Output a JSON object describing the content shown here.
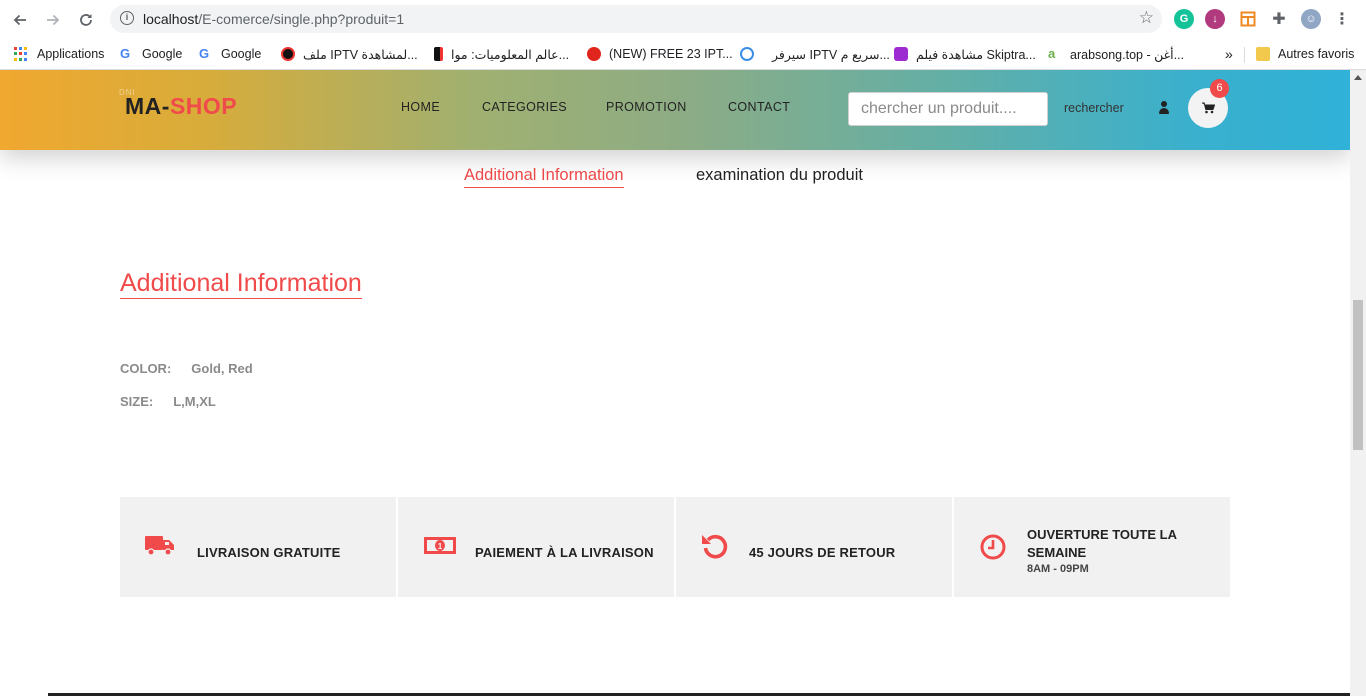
{
  "browser": {
    "url_host": "localhost",
    "url_path": "/E-comerce/single.php?produit=1",
    "bookmarks": [
      {
        "label": "Applications"
      },
      {
        "label": "Google"
      },
      {
        "label": "Google"
      },
      {
        "label": "ملف IPTV لمشاهدة..."
      },
      {
        "label": "عالم المعلوميات: موا..."
      },
      {
        "label": "(NEW) FREE 23 IPT..."
      },
      {
        "label": "سيرفر IPTV سريع م..."
      },
      {
        "label": "مشاهدة فيلم Skiptra..."
      },
      {
        "label": "arabsong.top - أغن..."
      }
    ],
    "more_bookmarks": "»",
    "other_bookmarks": "Autres favoris"
  },
  "header": {
    "logo_small": "DNI",
    "logo_ma": "MA-",
    "logo_shop": "SHOP",
    "menu": [
      "HOME",
      "CATEGORIES",
      "PROMOTION",
      "CONTACT"
    ],
    "search_placeholder": "chercher un produit....",
    "search_button": "rechercher",
    "cart_count": "6"
  },
  "tabs": {
    "active": "Additional Information",
    "other": "examination du produit"
  },
  "section": {
    "title": "Additional Information",
    "color_label": "COLOR:",
    "color_value": "Gold, Red",
    "size_label": "SIZE:",
    "size_value": "L,M,XL"
  },
  "features": {
    "shipping": "LIVRAISON GRATUITE",
    "payment": "PAIEMENT À LA LIVRAISON",
    "returns": "45 JOURS DE RETOUR",
    "hours_title": "OUVERTURE TOUTE LA SEMAINE",
    "hours_sub": "8AM - 09PM"
  },
  "colors": {
    "accent": "#f04a4a",
    "gradient_left": "#f0a830",
    "gradient_right": "#2fb1d8",
    "feature_bg": "#f1f1f1"
  }
}
